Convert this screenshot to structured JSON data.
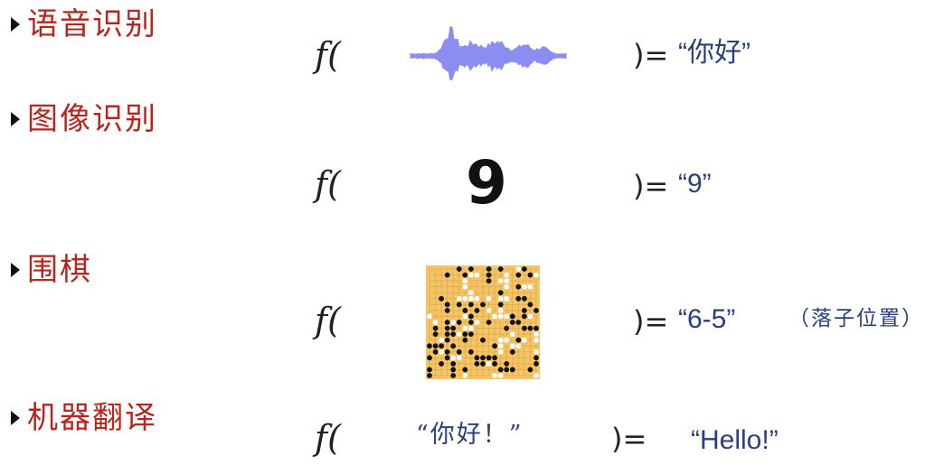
{
  "rows": [
    {
      "label": "语音识别",
      "func": "f(",
      "input_kind": "waveform",
      "close": ")=",
      "result": "“你好”"
    },
    {
      "label": "图像识别",
      "func": "f(",
      "input_kind": "digit-image",
      "input_text": "9",
      "close": ")=",
      "result": "“9”"
    },
    {
      "label": "围棋",
      "func": "f(",
      "input_kind": "go-board",
      "close": ")=",
      "result": "“6-5”",
      "note": "（落子位置）"
    },
    {
      "label": "机器翻译",
      "func": "f(",
      "input_kind": "text",
      "input_text": "“你好！”",
      "close": ")=",
      "result": "“Hello!”"
    }
  ],
  "colors": {
    "label": "#b5261e",
    "result": "#2b3f7a",
    "waveform": "#8c8df0",
    "board": "#f5c466",
    "stone_black": "#111111",
    "stone_white": "#ffffff"
  }
}
